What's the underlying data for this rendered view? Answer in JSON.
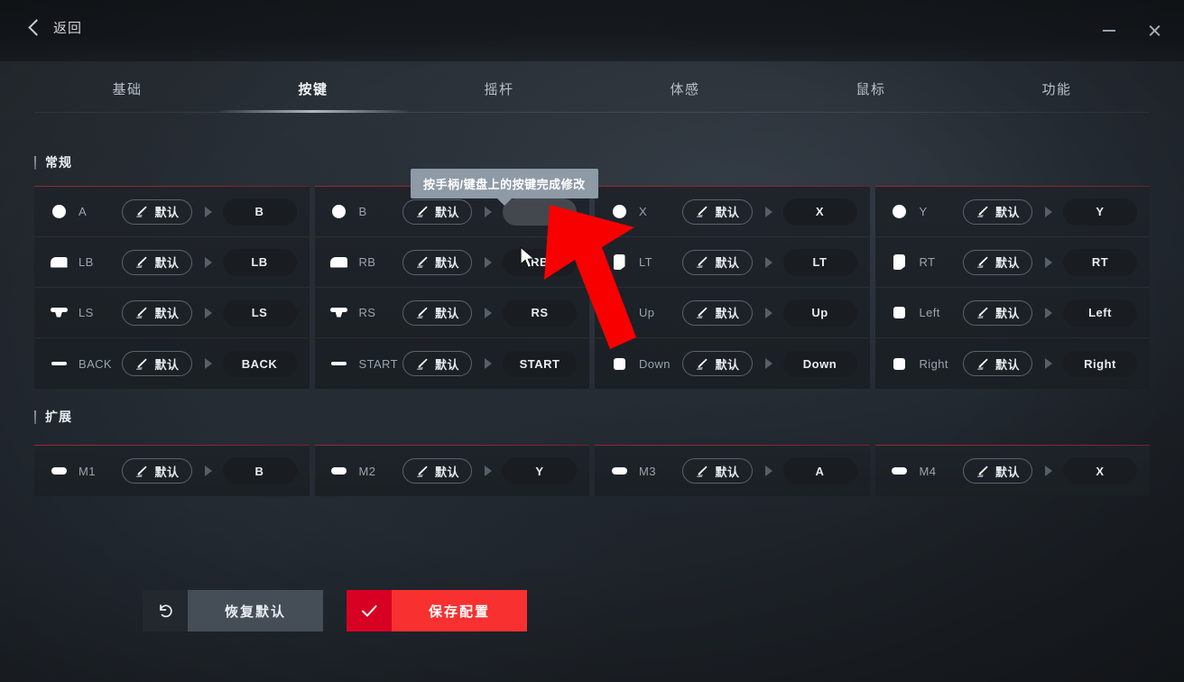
{
  "titlebar": {
    "back_label": "返回",
    "back_icon": "chevron-left-icon",
    "minimize_icon": "minimize-icon",
    "close_icon": "close-icon"
  },
  "tabs": [
    {
      "label": "基础",
      "active": false
    },
    {
      "label": "按键",
      "active": true
    },
    {
      "label": "摇杆",
      "active": false
    },
    {
      "label": "体感",
      "active": false
    },
    {
      "label": "鼠标",
      "active": false
    },
    {
      "label": "功能",
      "active": false
    }
  ],
  "tooltip": {
    "text": "按手柄/键盘上的按键完成修改"
  },
  "sections": [
    {
      "title": "常规",
      "columns": [
        {
          "rows": [
            {
              "icon": "face-button-icon",
              "label": "A",
              "mode": "默认",
              "value": "B",
              "editing": false
            },
            {
              "icon": "bumper-icon",
              "label": "LB",
              "mode": "默认",
              "value": "LB",
              "editing": false
            },
            {
              "icon": "stick-icon",
              "label": "LS",
              "mode": "默认",
              "value": "LS",
              "editing": false
            },
            {
              "icon": "dash-icon",
              "label": "BACK",
              "mode": "默认",
              "value": "BACK",
              "editing": false
            }
          ]
        },
        {
          "rows": [
            {
              "icon": "face-button-icon",
              "label": "B",
              "mode": "默认",
              "value": "",
              "editing": true
            },
            {
              "icon": "bumper-icon",
              "label": "RB",
              "mode": "默认",
              "value": "RB",
              "editing": false
            },
            {
              "icon": "stick-icon",
              "label": "RS",
              "mode": "默认",
              "value": "RS",
              "editing": false
            },
            {
              "icon": "dash-icon",
              "label": "START",
              "mode": "默认",
              "value": "START",
              "editing": false
            }
          ]
        },
        {
          "rows": [
            {
              "icon": "face-button-icon",
              "label": "X",
              "mode": "默认",
              "value": "X",
              "editing": false
            },
            {
              "icon": "trigger-icon",
              "label": "LT",
              "mode": "默认",
              "value": "LT",
              "editing": false
            },
            {
              "icon": "dpad-icon",
              "label": "Up",
              "mode": "默认",
              "value": "Up",
              "editing": false
            },
            {
              "icon": "dpad-icon",
              "label": "Down",
              "mode": "默认",
              "value": "Down",
              "editing": false
            }
          ]
        },
        {
          "rows": [
            {
              "icon": "face-button-icon",
              "label": "Y",
              "mode": "默认",
              "value": "Y",
              "editing": false
            },
            {
              "icon": "trigger-icon",
              "label": "RT",
              "mode": "默认",
              "value": "RT",
              "editing": false
            },
            {
              "icon": "dpad-icon",
              "label": "Left",
              "mode": "默认",
              "value": "Left",
              "editing": false
            },
            {
              "icon": "dpad-icon",
              "label": "Right",
              "mode": "默认",
              "value": "Right",
              "editing": false
            }
          ]
        }
      ]
    },
    {
      "title": "扩展",
      "columns": [
        {
          "rows": [
            {
              "icon": "paddle-icon",
              "label": "M1",
              "mode": "默认",
              "value": "B",
              "editing": false
            }
          ]
        },
        {
          "rows": [
            {
              "icon": "paddle-icon",
              "label": "M2",
              "mode": "默认",
              "value": "Y",
              "editing": false
            }
          ]
        },
        {
          "rows": [
            {
              "icon": "paddle-icon",
              "label": "M3",
              "mode": "默认",
              "value": "A",
              "editing": false
            }
          ]
        },
        {
          "rows": [
            {
              "icon": "paddle-icon",
              "label": "M4",
              "mode": "默认",
              "value": "X",
              "editing": false
            }
          ]
        }
      ]
    }
  ],
  "footer": {
    "restore": {
      "label": "恢复默认",
      "icon": "undo-icon"
    },
    "save": {
      "label": "保存配置",
      "icon": "check-icon"
    }
  },
  "colors": {
    "accent_red": "#f8302f",
    "accent_red_dark": "#d80022",
    "card_top_border": "#a02834",
    "tooltip_bg": "#8e9aa6",
    "annotation_arrow": "#f80000"
  }
}
